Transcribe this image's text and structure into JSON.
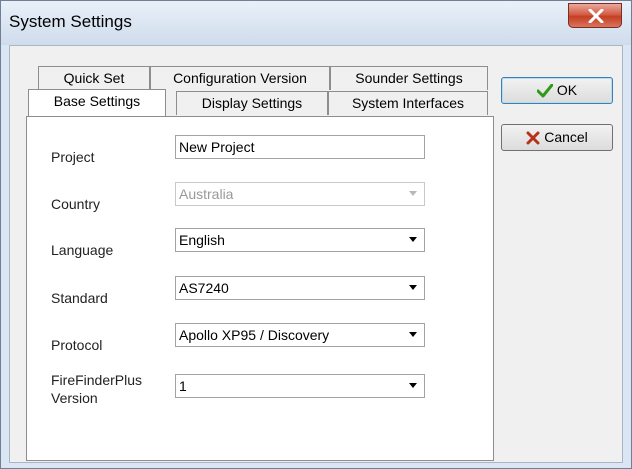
{
  "window": {
    "title": "System Settings"
  },
  "tabs": {
    "row1": [
      "Quick Set",
      "Configuration Version",
      "Sounder Settings"
    ],
    "row2": [
      "Base Settings",
      "Display Settings",
      "System Interfaces"
    ],
    "active": "Base Settings"
  },
  "form": {
    "project": {
      "label": "Project",
      "value": "New Project"
    },
    "country": {
      "label": "Country",
      "value": "Australia",
      "disabled": true
    },
    "language": {
      "label": "Language",
      "value": "English"
    },
    "standard": {
      "label": "Standard",
      "value": "AS7240"
    },
    "protocol": {
      "label": "Protocol",
      "value": "Apollo XP95 / Discovery"
    },
    "version": {
      "label": "FireFinderPlus Version",
      "value": "1"
    }
  },
  "buttons": {
    "ok": "OK",
    "cancel": "Cancel"
  },
  "icons": {
    "close": "close-icon",
    "ok": "checkmark-icon",
    "cancel": "x-mark-icon",
    "dropdown": "chevron-down-icon"
  },
  "colors": {
    "close_button": "#c7482c",
    "ok_check": "#2f9a17",
    "cancel_x": "#b5321b"
  }
}
